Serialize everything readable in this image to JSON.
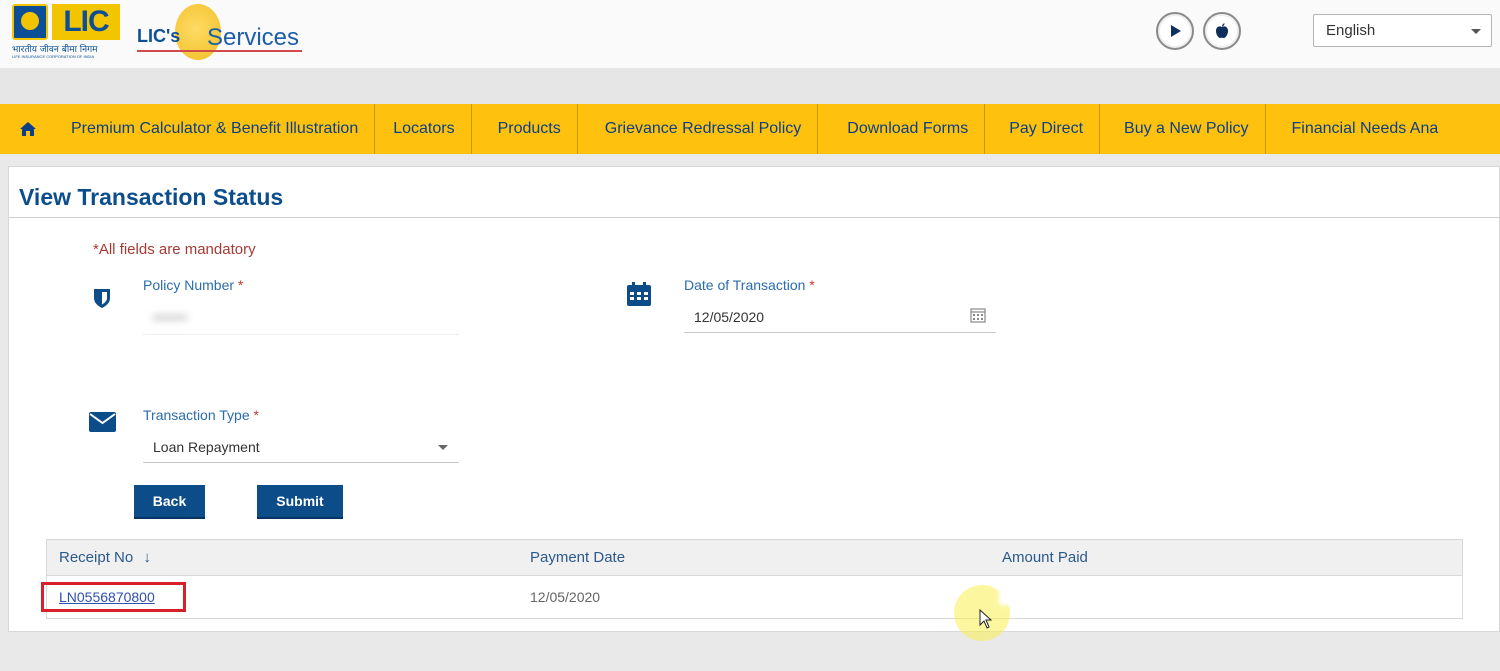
{
  "header": {
    "logo_text": "LIC",
    "logo_subtitle_hindi": "भारतीय जीवन बीमा निगम",
    "logo_subtitle_en": "LIFE INSURANCE CORPORATION OF INDIA",
    "eservices_prefix": "LIC's",
    "eservices_label": "Services",
    "language": "English",
    "play_store_icon": "play-icon",
    "app_store_icon": "apple-icon"
  },
  "nav": {
    "home_icon": "home-icon",
    "items": [
      "Premium Calculator & Benefit Illustration",
      "Locators",
      "Products",
      "Grievance Redressal Policy",
      "Download Forms",
      "Pay Direct",
      "Buy a New Policy",
      "Financial Needs Ana"
    ]
  },
  "page": {
    "title": "View Transaction Status",
    "mandatory_note": "*All fields are mandatory"
  },
  "form": {
    "policy_number": {
      "label": "Policy Number",
      "required": "*",
      "value": "•••••••",
      "icon": "shield-icon"
    },
    "date_of_transaction": {
      "label": "Date of Transaction",
      "required": "*",
      "value": "12/05/2020",
      "icon": "calendar-icon"
    },
    "transaction_type": {
      "label": "Transaction Type",
      "required": "*",
      "value": "Loan Repayment",
      "icon": "envelope-icon"
    },
    "back_label": "Back",
    "submit_label": "Submit"
  },
  "table": {
    "columns": [
      "Receipt No",
      "Payment Date",
      "Amount Paid"
    ],
    "sort_indicator": "↓",
    "rows": [
      {
        "receipt_no": "LN0556870800",
        "payment_date": "12/05/2020",
        "amount_paid": ""
      }
    ]
  },
  "colors": {
    "nav_bg": "#fec20e",
    "brand_blue": "#0c4e8c",
    "button_bg": "#0b4c89",
    "highlight_red": "#d8202a"
  }
}
